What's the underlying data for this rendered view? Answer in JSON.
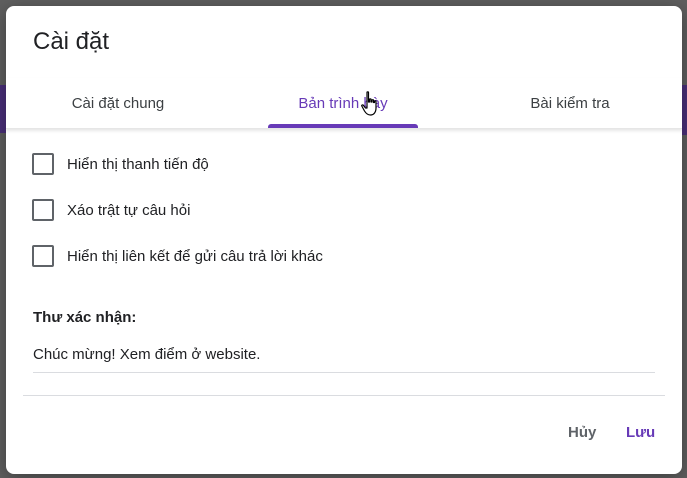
{
  "dialog": {
    "title": "Cài đặt"
  },
  "tabs": [
    {
      "label": "Cài đặt chung",
      "active": false
    },
    {
      "label": "Bản trình bày",
      "active": true
    },
    {
      "label": "Bài kiểm tra",
      "active": false
    }
  ],
  "options": [
    {
      "label": "Hiển thị thanh tiến độ",
      "checked": false
    },
    {
      "label": "Xáo trật tự câu hỏi",
      "checked": false
    },
    {
      "label": "Hiển thị liên kết để gửi câu trả lời khác",
      "checked": false
    }
  ],
  "confirmation": {
    "label": "Thư xác nhận:",
    "value": "Chúc mừng!  Xem điểm ở website."
  },
  "footer": {
    "cancel_label": "Hủy",
    "save_label": "Lưu"
  },
  "colors": {
    "accent": "#673ab7",
    "overlay": "#5f5f5f"
  },
  "icons": {
    "cursor": "hand-pointer-icon"
  }
}
